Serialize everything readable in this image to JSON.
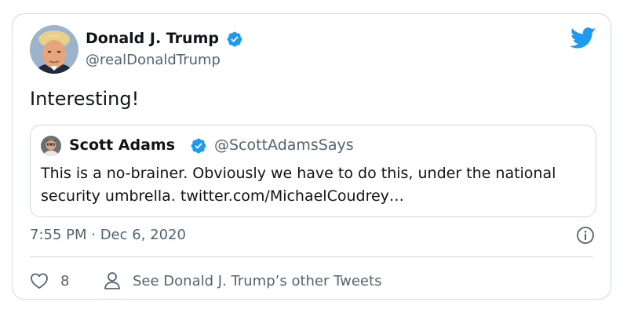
{
  "tweet": {
    "author_name": "Donald J. Trump",
    "author_handle": "@realDonaldTrump",
    "text": "Interesting!",
    "timestamp": "7:55 PM · Dec 6, 2020"
  },
  "quoted_tweet": {
    "author_name": "Scott Adams",
    "author_handle": "@ScottAdamsSays",
    "text": "This is a no-brainer. Obviously we have to do this, under the national security umbrella. twitter.com/MichaelCoudrey…"
  },
  "actions": {
    "like_count": "8",
    "profile_link_label": "See Donald J. Trump’s other Tweets"
  },
  "icons": {
    "brand": "twitter-bird-icon",
    "verified": "verified-badge-icon",
    "info": "info-icon",
    "like": "heart-icon",
    "profile": "person-icon"
  },
  "colors": {
    "twitter_blue": "#1d9bf0",
    "text_primary": "#0f1419",
    "text_secondary": "#536471",
    "border": "#cfd9de"
  }
}
